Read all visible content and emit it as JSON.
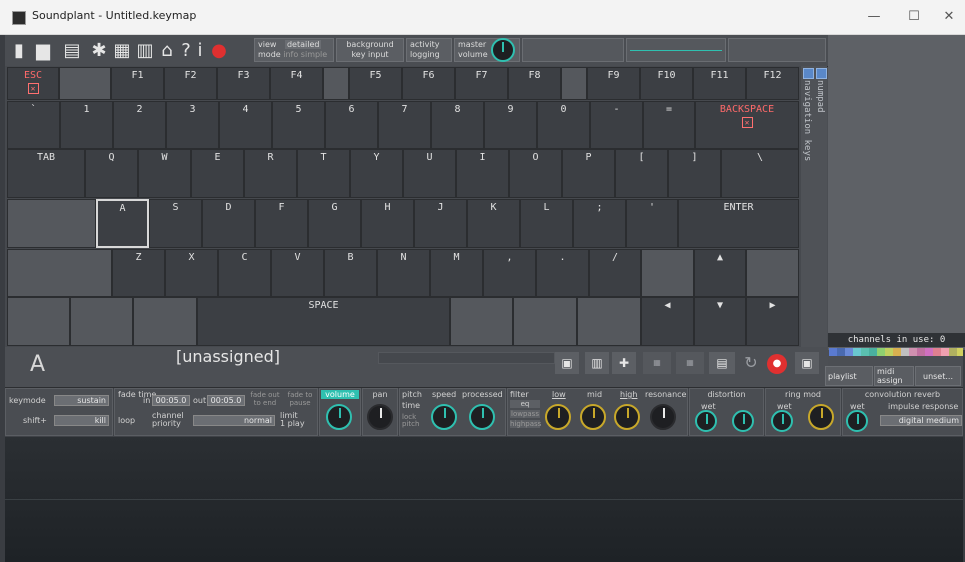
{
  "window": {
    "title": "Soundplant - Untitled.keymap",
    "minimize": "—",
    "maximize": "☐",
    "close": "✕"
  },
  "toolbar": {
    "icons": [
      "new-file-icon",
      "open-folder-icon",
      "save-icon",
      "settings-icon",
      "keyboard-icon",
      "list-icon",
      "home-icon",
      "help-icon",
      "info-icon",
      "record-icon"
    ],
    "view_label": "view",
    "view_mode": "mode",
    "view_detailed": "detailed",
    "view_info": "info",
    "view_simple": "simple",
    "background_label": "background",
    "key_input_label": "key input",
    "activity_label": "activity",
    "logging_label": "logging",
    "master_label": "master",
    "volume_label": "volume"
  },
  "keyboard": {
    "row0": [
      "ESC",
      "",
      "F1",
      "F2",
      "F3",
      "F4",
      "",
      "F5",
      "F6",
      "F7",
      "F8",
      "",
      "F9",
      "F10",
      "F11",
      "F12"
    ],
    "row1": [
      "`",
      "1",
      "2",
      "3",
      "4",
      "5",
      "6",
      "7",
      "8",
      "9",
      "0",
      "-",
      "=",
      "BACKSPACE"
    ],
    "row2": [
      "TAB",
      "Q",
      "W",
      "E",
      "R",
      "T",
      "Y",
      "U",
      "I",
      "O",
      "P",
      "[",
      "]",
      "\\"
    ],
    "row3": [
      "",
      "A",
      "S",
      "D",
      "F",
      "G",
      "H",
      "J",
      "K",
      "L",
      ";",
      "'",
      "ENTER"
    ],
    "row4": [
      "",
      "Z",
      "X",
      "C",
      "V",
      "B",
      "N",
      "M",
      ",",
      ".",
      "/",
      "",
      "▲",
      ""
    ],
    "row5": [
      "",
      "",
      "",
      "SPACE",
      "",
      "",
      "",
      "◀",
      "▼",
      "▶"
    ],
    "nav_label": "navigation keys",
    "numpad_label": "numpad",
    "selected_key": "A"
  },
  "status": {
    "channels_in_use": "channels in use: 0"
  },
  "info": {
    "key_letter": "A",
    "assigned": "[unassigned]"
  },
  "controls": {
    "keymode_label": "keymode",
    "keymode_value": "sustain",
    "shift_label": "shift+",
    "shift_value": "kill",
    "fade_time_label": "fade time",
    "fade_in_label": "in",
    "fade_in_value": "00:05.0",
    "fade_out_label": "out",
    "fade_out_value": "00:05.0",
    "fade_out_to_end": "fade out to end",
    "fade_to_pause": "fade to pause",
    "loop_label": "loop",
    "channel_priority_label": "channel priority",
    "channel_priority_value": "normal",
    "limit_label": "limit",
    "limit_value": "1 play",
    "volume_label": "volume",
    "pan_label": "pan",
    "pitch_label": "pitch",
    "speed_label": "speed",
    "processed_label": "processed",
    "time_label": "time",
    "lock_label": "lock",
    "pitch2_label": "pitch",
    "filter_label": "filter",
    "eq_label": "eq",
    "lowpass_label": "lowpass",
    "highpass_label": "highpass",
    "low_label": "low",
    "mid_label": "mid",
    "high_label": "high",
    "resonance_label": "resonance",
    "distortion_label": "distortion",
    "wet_label": "wet",
    "ring_mod_label": "ring mod",
    "reverb_label": "convolution reverb",
    "impulse_label": "impulse response",
    "impulse_value": "digital medium",
    "playlist_label": "playlist",
    "midi_label": "midi",
    "assign_label": "assign",
    "unset_label": "unset..."
  },
  "colors": {
    "accent_teal": "#2fc0b0",
    "accent_gold": "#c8a82a",
    "esc_red": "#ff6a6a",
    "selection": "#d8d8d8"
  }
}
